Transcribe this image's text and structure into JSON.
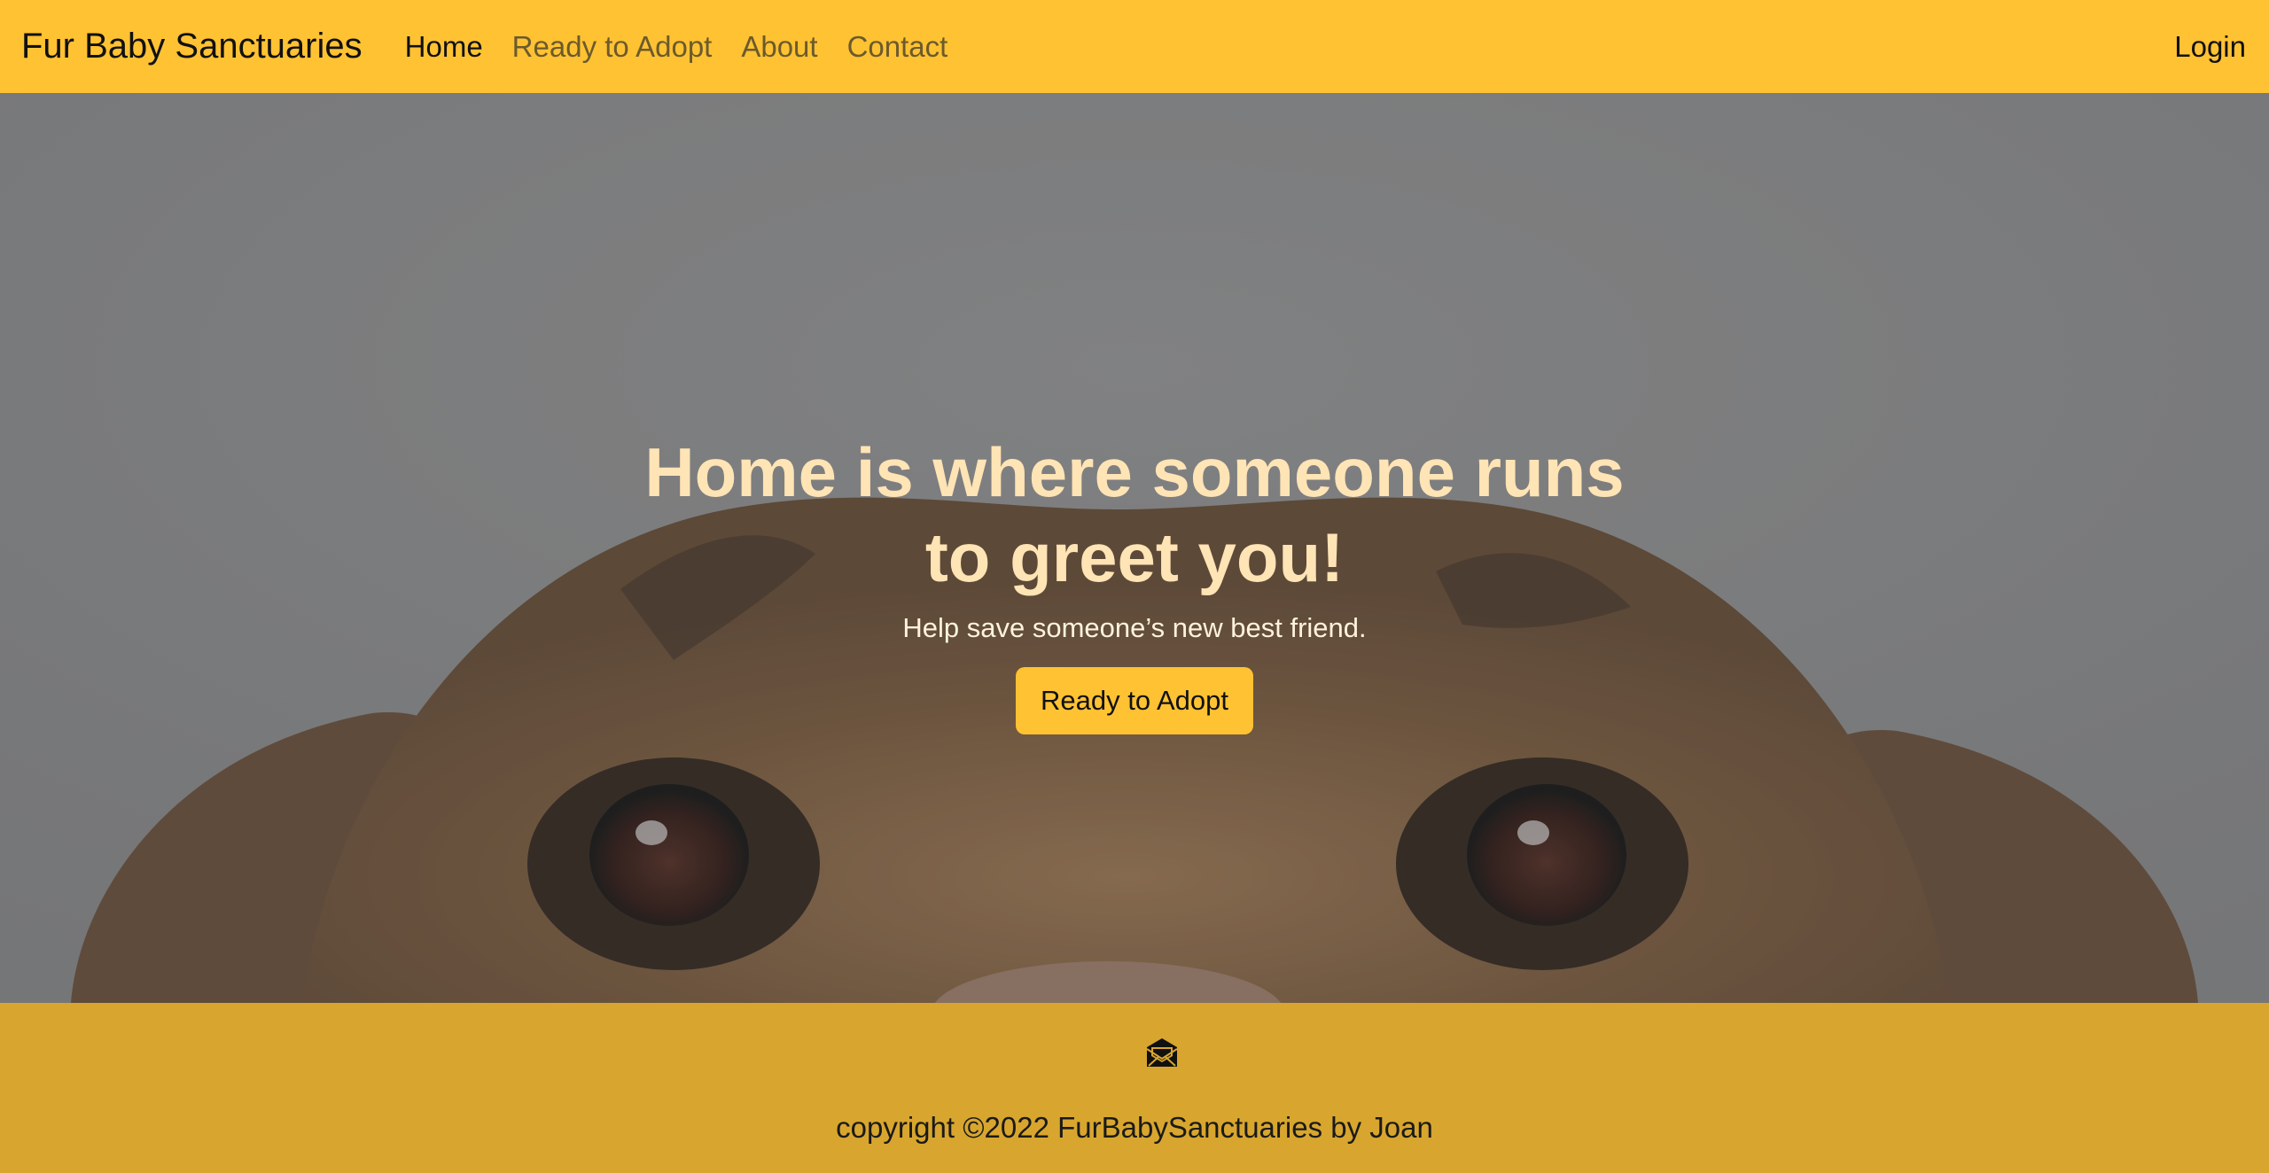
{
  "navbar": {
    "brand": "Fur Baby Sanctuaries",
    "links": [
      {
        "label": "Home",
        "active": true
      },
      {
        "label": "Ready to Adopt",
        "active": false
      },
      {
        "label": "About",
        "active": false
      },
      {
        "label": "Contact",
        "active": false
      }
    ],
    "login_label": "Login"
  },
  "hero": {
    "title": "Home is where someone runs to greet you!",
    "subtitle": "Help save someone’s new best friend.",
    "button_label": "Ready to Adopt"
  },
  "footer": {
    "icon": "envelope-open-icon",
    "copyright": "copyright ©2022 FurBabySanctuaries by Joan"
  },
  "colors": {
    "primary": "#ffc233",
    "footer": "#d8a62e",
    "hero_text": "#ffe4b5"
  }
}
